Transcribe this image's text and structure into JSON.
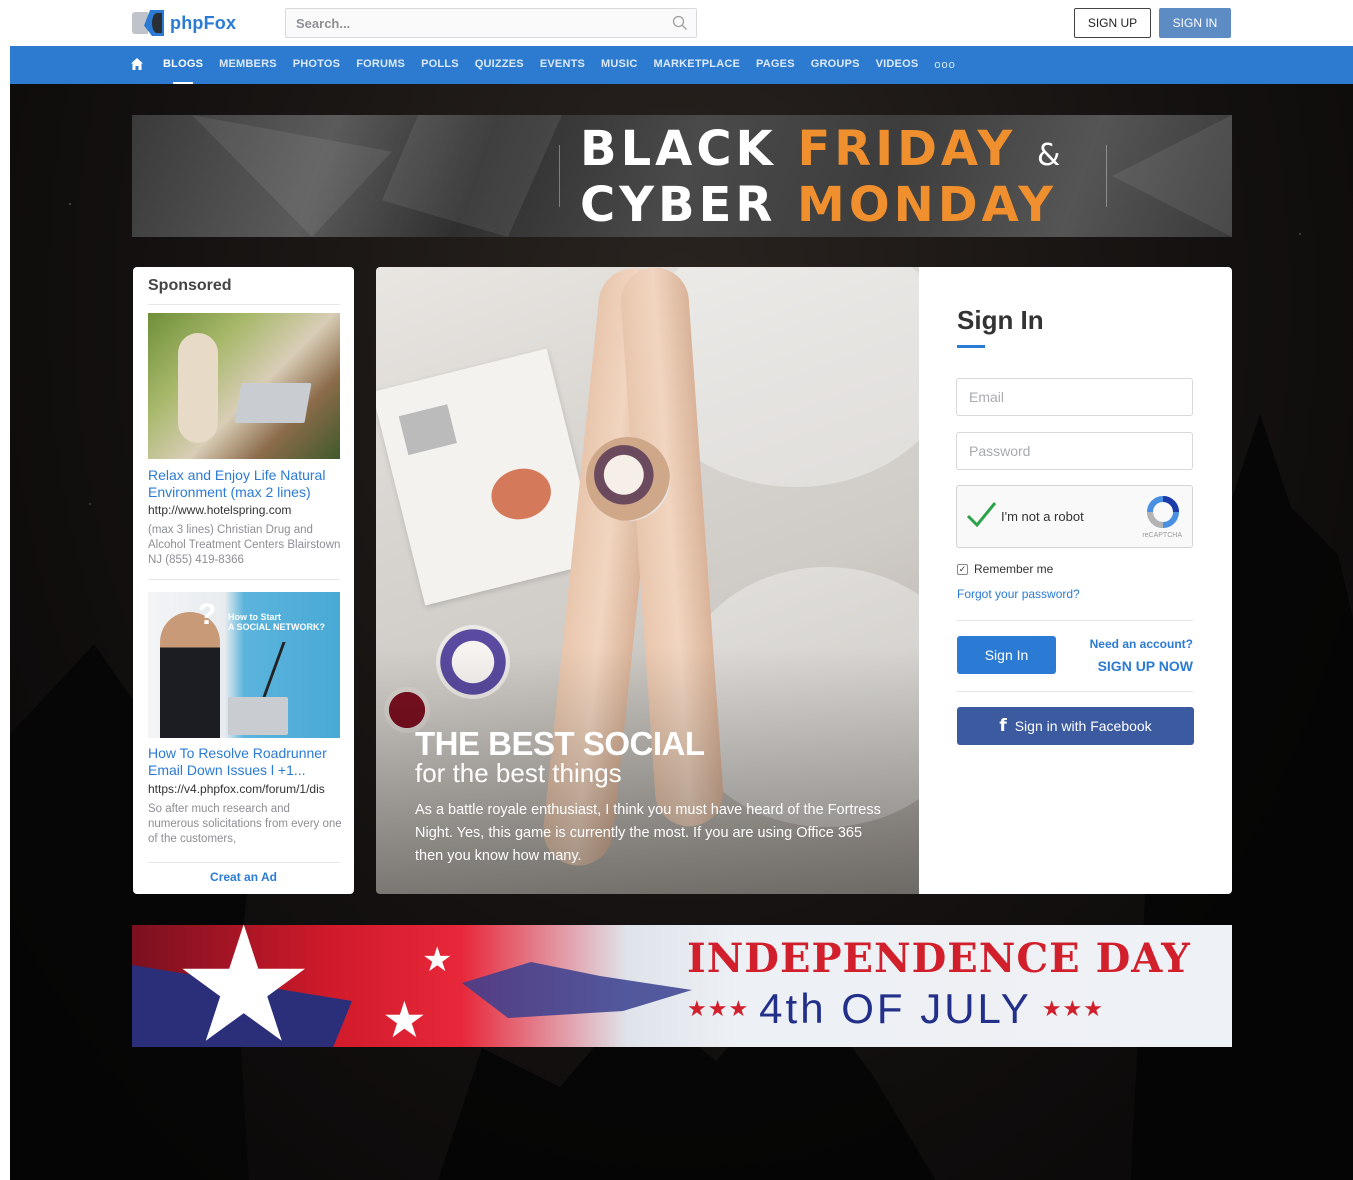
{
  "header": {
    "logo_text": "phpFox",
    "search_placeholder": "Search...",
    "signup_label": "SIGN UP",
    "signin_label": "SIGN IN"
  },
  "nav": {
    "home_icon": "home-icon",
    "items": [
      "BLOGS",
      "MEMBERS",
      "PHOTOS",
      "FORUMS",
      "POLLS",
      "QUIZZES",
      "EVENTS",
      "MUSIC",
      "MARKETPLACE",
      "PAGES",
      "GROUPS",
      "VIDEOS"
    ],
    "active_index": 0,
    "more_label": "ooo"
  },
  "banner_top": {
    "line1_white": "BLACK",
    "line1_orange": "FRIDAY",
    "amp": "&",
    "line2_white": "CYBER",
    "line2_orange": "MONDAY"
  },
  "sponsored": {
    "title": "Sponsored",
    "ads": [
      {
        "title": "Relax and Enjoy Life Natural Environment (max 2 lines)",
        "url": "http://www.hotelspring.com",
        "description": "(max 3 lines) Christian Drug and Alcohol Treatment Centers Blairstown NJ (855) 419-8366"
      },
      {
        "title": "How To Resolve Roadrunner Email Down Issues l +1...",
        "url": "https://v4.phpfox.com/forum/1/dis",
        "description": "So after much research and numerous solicitations from every one of the customers,",
        "image_text_1": "How to Start",
        "image_text_2": "A SOCIAL NETWORK?",
        "image_q": "?"
      }
    ],
    "create_label": "Creat an Ad"
  },
  "hero": {
    "title": "THE BEST SOCIAL",
    "subtitle": "for the best things",
    "text": "As a battle royale enthusiast, I think you must have heard of the Fortress Night. Yes, this game is currently the most.  If you are using Office 365 then you know how many."
  },
  "signin": {
    "title": "Sign In",
    "email_placeholder": "Email",
    "password_placeholder": "Password",
    "captcha_label": "I'm not a robot",
    "captcha_brand": "reCAPTCHA",
    "remember_label": "Remember me",
    "remember_check": "✓",
    "forgot_label": "Forgot your password?",
    "button_label": "Sign In",
    "need_account": "Need an account?",
    "signup_now": "SIGN UP NOW",
    "facebook_label": "Sign in with Facebook",
    "facebook_f": "f"
  },
  "banner_bottom": {
    "title": "INDEPENDENCE DAY",
    "stars": "★★★",
    "subtitle": "4th OF JULY"
  },
  "colors": {
    "accent": "#2b7bd4",
    "nav_bg": "#2c7bd0",
    "banner_orange": "#f08f2e",
    "facebook": "#3b5aa0",
    "independence_red": "#d11f2c",
    "independence_blue": "#23308a"
  }
}
